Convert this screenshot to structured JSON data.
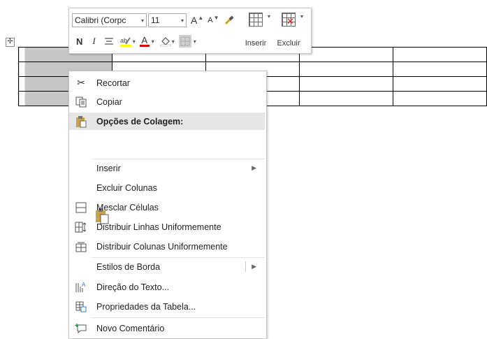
{
  "table": {
    "rows": 4,
    "cols": 5
  },
  "toolbar": {
    "font_name": "Calibri (Corpc",
    "font_size": "11",
    "grow_font": "A",
    "shrink_font": "A",
    "bold": "N",
    "italic": "I",
    "font_color_letter": "A",
    "insert_label": "Inserir",
    "delete_label": "Excluir"
  },
  "menu": {
    "cut": "Recortar",
    "copy": "Copiar",
    "paste_options": "Opções de Colagem:",
    "insert": "Inserir",
    "delete_columns": "Excluir Colunas",
    "merge_cells": "Mesclar Células",
    "distribute_rows": "Distribuir Linhas Uniformemente",
    "distribute_columns": "Distribuir Colunas Uniformemente",
    "border_styles": "Estilos de Borda",
    "text_direction": "Direção do Texto...",
    "table_properties": "Propriedades da Tabela...",
    "new_comment": "Novo Comentário"
  }
}
